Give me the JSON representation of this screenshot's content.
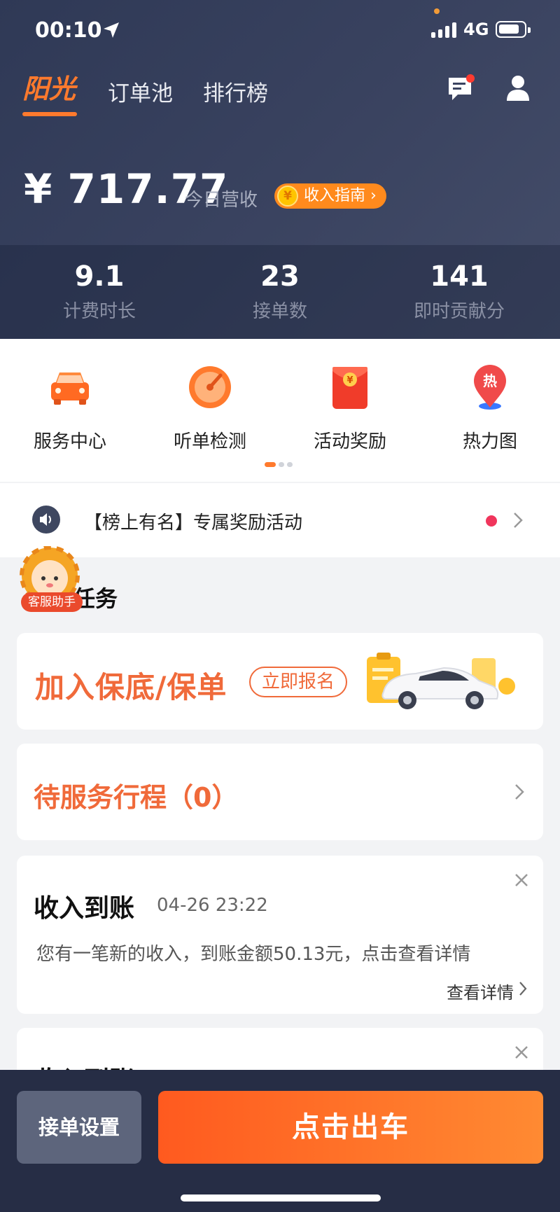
{
  "status_bar": {
    "time": "00:10",
    "network": "4G"
  },
  "nav": {
    "tabs": [
      {
        "label": "阳光",
        "active": true
      },
      {
        "label": "订单池"
      },
      {
        "label": "排行榜"
      }
    ]
  },
  "earnings": {
    "amount": "¥ 717.77",
    "label": "今日营收",
    "guide_label": "收入指南 ›",
    "coin_symbol": "¥"
  },
  "stats": [
    {
      "value": "9.1",
      "label": "计费时长"
    },
    {
      "value": "23",
      "label": "接单数"
    },
    {
      "value": "141",
      "label": "即时贡献分"
    }
  ],
  "quick_actions": [
    {
      "label": "服务中心",
      "icon": "car-icon"
    },
    {
      "label": "听单检测",
      "icon": "gauge-icon"
    },
    {
      "label": "活动奖励",
      "icon": "red-envelope-icon"
    },
    {
      "label": "热力图",
      "icon": "heatmap-pin-icon",
      "icon_text": "热"
    }
  ],
  "notice": {
    "text": "【榜上有名】专属奖励活动"
  },
  "helper": {
    "badge": "客服助手"
  },
  "section": {
    "title": "待办任务",
    "visible_title": "任务"
  },
  "promo_card": {
    "title": "加入保底/保单",
    "button": "立即报名"
  },
  "pending_card": {
    "title": "待服务行程（0）"
  },
  "income_card": {
    "title": "收入到账",
    "time": "04-26 23:22",
    "body": "您有一笔新的收入，到账金额50.13元，点击查看详情",
    "link": "查看详情"
  },
  "income_card_2": {
    "title": "收入到账"
  },
  "bottom_bar": {
    "settings_label": "接单设置",
    "go_label": "点击出车"
  },
  "colors": {
    "accent": "#ff7a2d",
    "header_bg": "#39425f",
    "card_title": "#f06a3a",
    "bottom_bg": "#262d45"
  }
}
